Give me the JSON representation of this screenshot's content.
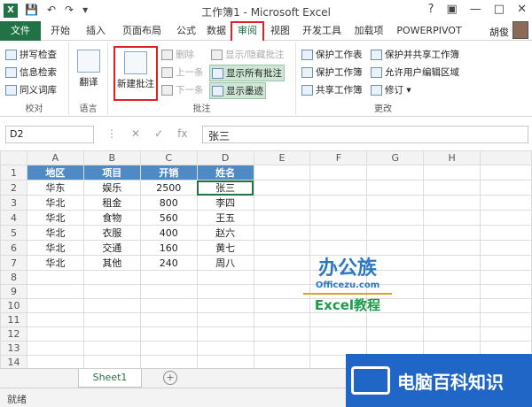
{
  "window": {
    "title": "工作簿1 - Microsoft Excel",
    "user": "胡俊",
    "qat": [
      "💾",
      "↶",
      "↷",
      "▾"
    ],
    "controls": [
      "?",
      "▣",
      "—",
      "□",
      "✕"
    ]
  },
  "tabs": [
    "文件",
    "开始",
    "插入",
    "页面布局",
    "公式",
    "数据",
    "审阅",
    "视图",
    "开发工具",
    "加载项",
    "POWERPIVOT"
  ],
  "ribbon": {
    "proofing": {
      "items": [
        "拼写检查",
        "信息检索",
        "同义词库"
      ],
      "group": "校对"
    },
    "language": {
      "button": "翻译",
      "group": "语言"
    },
    "comments": {
      "new_comment": "新建批注",
      "items": [
        "删除",
        "上一条",
        "下一条"
      ],
      "show_items": [
        "显示/隐藏批注",
        "显示所有批注",
        "显示墨迹"
      ],
      "group": "批注"
    },
    "changes": {
      "items": [
        "保护工作表",
        "保护工作簿",
        "共享工作簿"
      ],
      "items2": [
        "保护并共享工作簿",
        "允许用户编辑区域",
        "修订 ▾"
      ],
      "group": "更改"
    }
  },
  "formula_bar": {
    "namebox": "D2",
    "icons": [
      "⋮",
      "✕",
      "✓",
      "fx"
    ],
    "value": "张三"
  },
  "sheet": {
    "columns": [
      "A",
      "B",
      "C",
      "D",
      "E",
      "F",
      "G",
      "H"
    ],
    "headers": [
      "地区",
      "项目",
      "开销",
      "姓名"
    ],
    "rows": [
      [
        "华东",
        "娱乐",
        "2500",
        "张三"
      ],
      [
        "华北",
        "租金",
        "800",
        "李四"
      ],
      [
        "华北",
        "食物",
        "560",
        "王五"
      ],
      [
        "华北",
        "衣服",
        "400",
        "赵六"
      ],
      [
        "华北",
        "交通",
        "160",
        "黄七"
      ],
      [
        "华北",
        "其他",
        "240",
        "周八"
      ]
    ],
    "row_numbers": [
      "1",
      "2",
      "3",
      "4",
      "5",
      "6",
      "7",
      "8",
      "9",
      "10",
      "11",
      "12",
      "13",
      "14"
    ]
  },
  "logo": {
    "title": "办公族",
    "url": "Officezu.com",
    "subtitle": "Excel教程"
  },
  "sheet_tab": "Sheet1",
  "add_sheet": "+",
  "status": "就绪",
  "watermark": "电脑百科知识",
  "colors": {
    "accent": "#217346",
    "header_fill": "#4e8bc6",
    "highlight": "#dd2222"
  }
}
